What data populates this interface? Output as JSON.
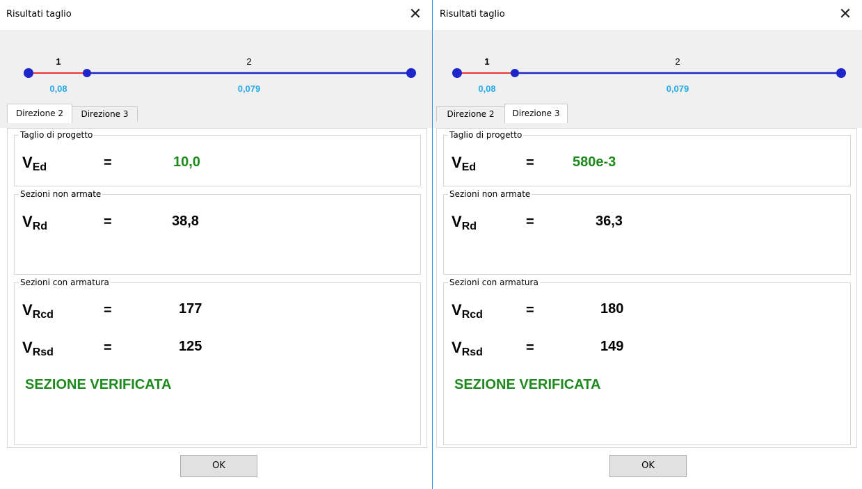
{
  "windows": [
    {
      "title": "Risultati taglio",
      "close_glyph": "✕",
      "beam": {
        "segment_labels": [
          "1",
          "2"
        ],
        "segment_values": [
          "0,08",
          "0,079"
        ],
        "colors": {
          "segment1": "#e8332e",
          "segment2": "#1f26c9",
          "nodes": "#1f26c9",
          "values": "#23a9e8"
        }
      },
      "tabs": [
        {
          "label": "Direzione 2",
          "active": true
        },
        {
          "label": "Direzione 3",
          "active": false
        }
      ],
      "groups": {
        "taglio": {
          "legend": "Taglio di progetto",
          "symbol": "V",
          "sub": "Ed",
          "eq": "=",
          "value": "10,0"
        },
        "non_armate": {
          "legend": "Sezioni non armate",
          "symbol": "V",
          "sub": "Rd",
          "eq": "=",
          "value": "38,8"
        },
        "con_armatura": {
          "legend": "Sezioni con armatura",
          "rows": [
            {
              "symbol": "V",
              "sub": "Rcd",
              "eq": "=",
              "value": "177"
            },
            {
              "symbol": "V",
              "sub": "Rsd",
              "eq": "=",
              "value": "125"
            }
          ],
          "status": "SEZIONE VERIFICATA"
        }
      },
      "ok_label": "OK"
    },
    {
      "title": "Risultati taglio",
      "close_glyph": "✕",
      "beam": {
        "segment_labels": [
          "1",
          "2"
        ],
        "segment_values": [
          "0,08",
          "0,079"
        ],
        "colors": {
          "segment1": "#e8332e",
          "segment2": "#1f26c9",
          "nodes": "#1f26c9",
          "values": "#23a9e8"
        }
      },
      "tabs": [
        {
          "label": "Direzione 2",
          "active": false
        },
        {
          "label": "Direzione 3",
          "active": true
        }
      ],
      "groups": {
        "taglio": {
          "legend": "Taglio di progetto",
          "symbol": "V",
          "sub": "Ed",
          "eq": "=",
          "value": "580e-3"
        },
        "non_armate": {
          "legend": "Sezioni non armate",
          "symbol": "V",
          "sub": "Rd",
          "eq": "=",
          "value": "36,3"
        },
        "con_armatura": {
          "legend": "Sezioni con armatura",
          "rows": [
            {
              "symbol": "V",
              "sub": "Rcd",
              "eq": "=",
              "value": "180"
            },
            {
              "symbol": "V",
              "sub": "Rsd",
              "eq": "=",
              "value": "149"
            }
          ],
          "status": "SEZIONE VERIFICATA"
        }
      },
      "ok_label": "OK"
    }
  ]
}
